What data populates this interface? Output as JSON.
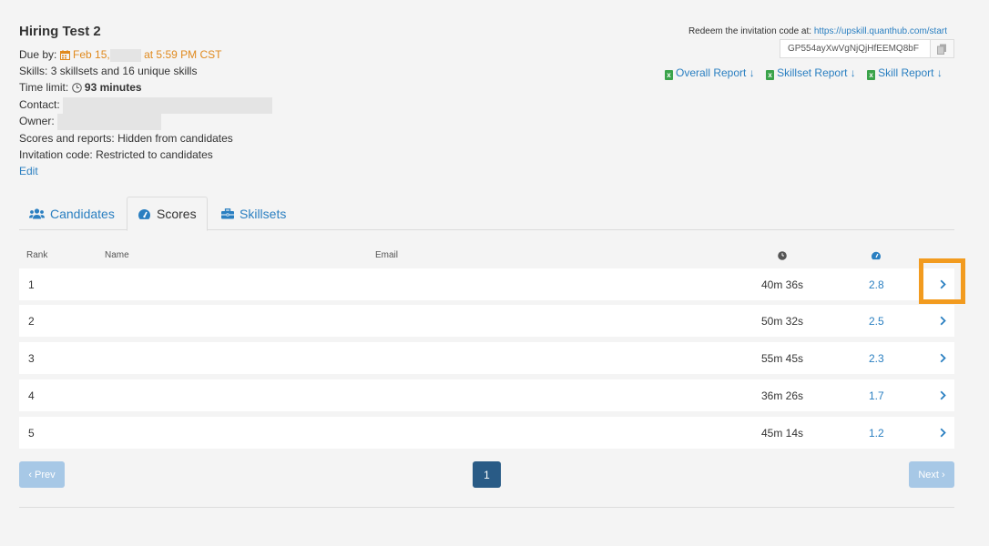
{
  "test": {
    "title": "Hiring Test 2",
    "due_label": "Due by:",
    "due_date": "Feb 15,",
    "due_time": "at 5:59 PM CST",
    "skills_label": "Skills:",
    "skills_value": "3 skillsets and 16 unique skills",
    "time_limit_label": "Time limit:",
    "time_limit_value": "93 minutes",
    "contact_label": "Contact:",
    "owner_label": "Owner:",
    "scores_reports_label": "Scores and reports:",
    "scores_reports_value": "Hidden from candidates",
    "invitation_label": "Invitation code:",
    "invitation_value": "Restricted to candidates",
    "edit_label": "Edit"
  },
  "redeem": {
    "text": "Redeem the invitation code at:",
    "url": "https://upskill.quanthub.com/start",
    "code": "GP554ayXwVgNjQjHfEEMQ8bF"
  },
  "reports": {
    "overall": "Overall Report",
    "skillset": "Skillset Report",
    "skill": "Skill Report"
  },
  "tabs": [
    {
      "label": "Candidates"
    },
    {
      "label": "Scores"
    },
    {
      "label": "Skillsets"
    }
  ],
  "table": {
    "headers": {
      "rank": "Rank",
      "name": "Name",
      "email": "Email"
    },
    "rows": [
      {
        "rank": "1",
        "time": "40m 36s",
        "score": "2.8"
      },
      {
        "rank": "2",
        "time": "50m 32s",
        "score": "2.5"
      },
      {
        "rank": "3",
        "time": "55m 45s",
        "score": "2.3"
      },
      {
        "rank": "4",
        "time": "36m 26s",
        "score": "1.7"
      },
      {
        "rank": "5",
        "time": "45m 14s",
        "score": "1.2"
      }
    ]
  },
  "pagination": {
    "prev": "‹ Prev",
    "page": "1",
    "next": "Next ›"
  },
  "colors": {
    "accent": "#2a7fc1",
    "due": "#e08a1e",
    "highlight": "#f29b1f",
    "page_active": "#295b86"
  }
}
